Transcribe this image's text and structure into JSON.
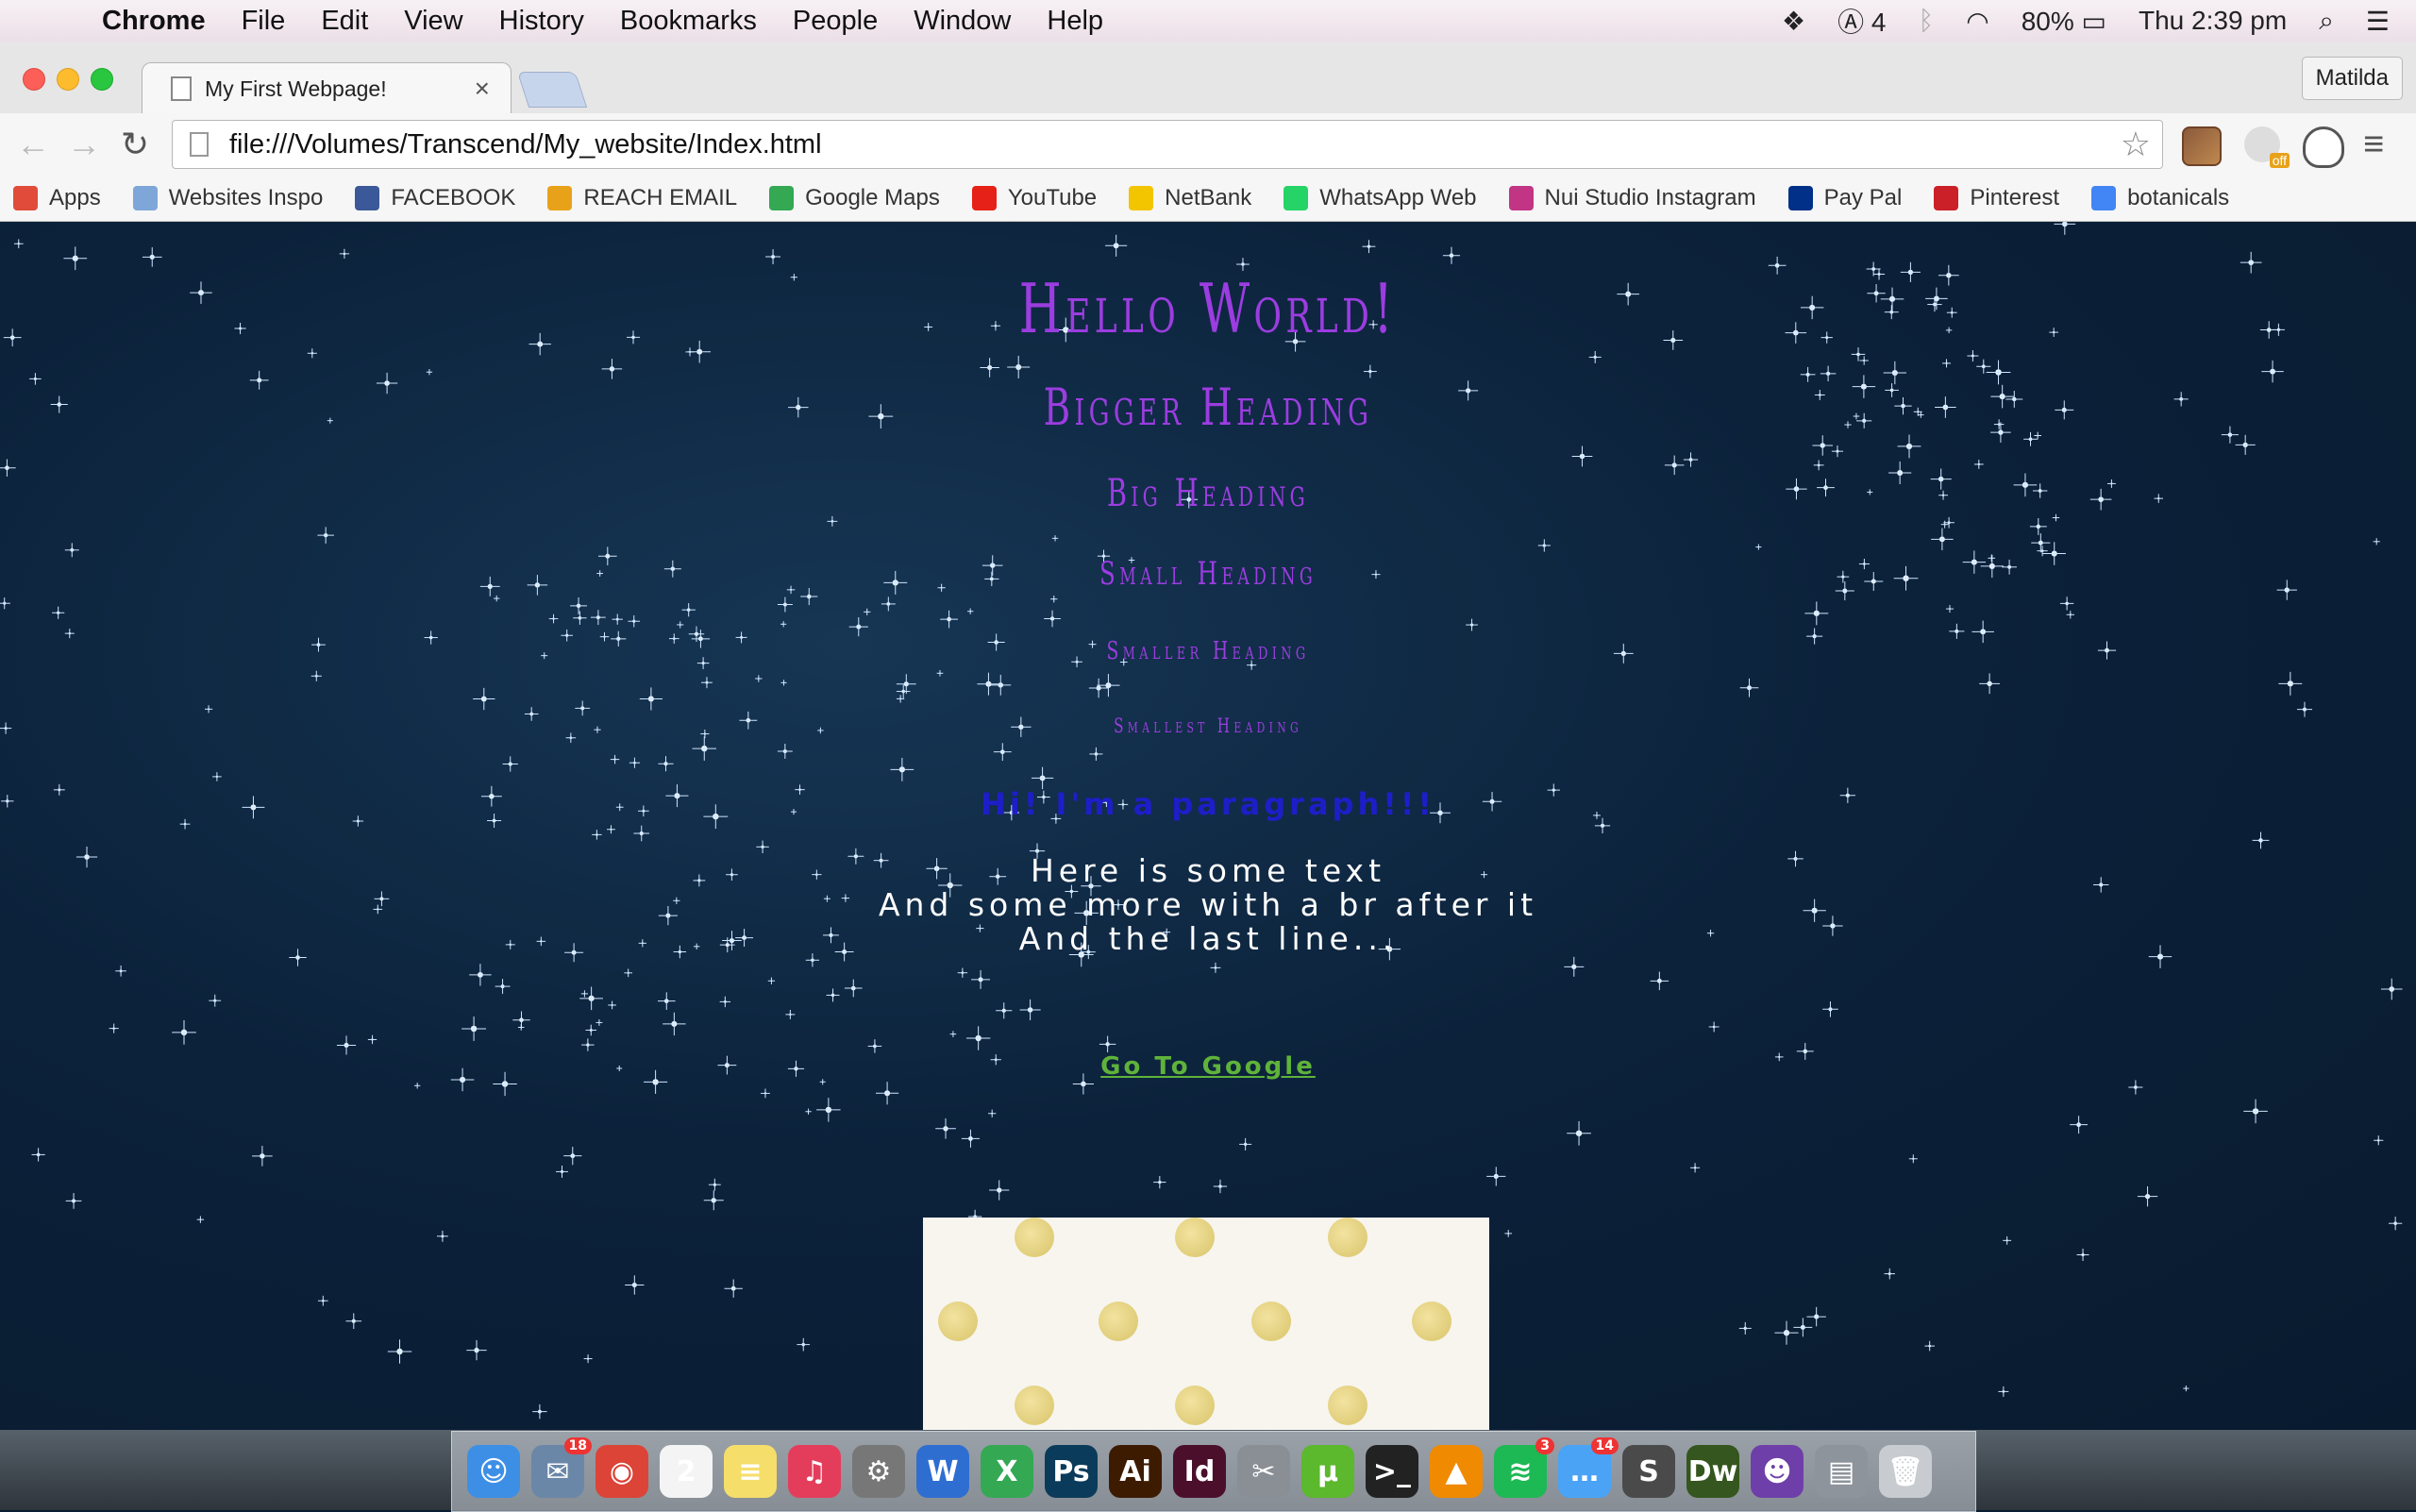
{
  "menubar": {
    "app": "Chrome",
    "items": [
      "File",
      "Edit",
      "View",
      "History",
      "Bookmarks",
      "People",
      "Window",
      "Help"
    ],
    "adobe_count": "4",
    "battery": "80%",
    "clock": "Thu 2:39 pm"
  },
  "browser": {
    "tab_title": "My First Webpage!",
    "profile_name": "Matilda",
    "url": "file:///Volumes/Transcend/My_website/Index.html",
    "bookmarks": [
      {
        "label": "Apps",
        "icon": "apps-grid-icon",
        "color": "#e04b3a"
      },
      {
        "label": "Websites Inspo",
        "icon": "folder-icon",
        "color": "#7ea6d8"
      },
      {
        "label": "FACEBOOK",
        "icon": "facebook-icon",
        "color": "#3b5998"
      },
      {
        "label": "REACH EMAIL",
        "icon": "outlook-icon",
        "color": "#e8a21a"
      },
      {
        "label": "Google Maps",
        "icon": "maps-icon",
        "color": "#34a853"
      },
      {
        "label": "YouTube",
        "icon": "youtube-icon",
        "color": "#e62117"
      },
      {
        "label": "NetBank",
        "icon": "netbank-icon",
        "color": "#f2c500"
      },
      {
        "label": "WhatsApp Web",
        "icon": "whatsapp-icon",
        "color": "#25d366"
      },
      {
        "label": "Nui Studio Instagram",
        "icon": "instagram-icon",
        "color": "#c13584"
      },
      {
        "label": "Pay Pal",
        "icon": "paypal-icon",
        "color": "#003087"
      },
      {
        "label": "Pinterest",
        "icon": "pinterest-icon",
        "color": "#cb2027"
      },
      {
        "label": "botanicals",
        "icon": "google-icon",
        "color": "#4285f4"
      }
    ]
  },
  "page": {
    "h1": "Hello World!",
    "h2": "Bigger Heading",
    "h3": "Big Heading",
    "h4": "Small Heading",
    "h5": "Smaller Heading",
    "h6": "Smallest Heading",
    "paragraph": "Hi! I'm a paragraph!!!",
    "text_lines": [
      "Here is some text",
      "And some more with a br after it",
      "And the last line..."
    ],
    "link": "Go To Google"
  },
  "dock": {
    "apps": [
      {
        "name": "finder-icon",
        "glyph": "☺",
        "color": "#3d8fe6"
      },
      {
        "name": "mail-icon",
        "glyph": "✉",
        "color": "#6b87a8",
        "badge": "18"
      },
      {
        "name": "chrome-icon",
        "glyph": "◉",
        "color": "#db4437"
      },
      {
        "name": "calendar-icon",
        "glyph": "2",
        "color": "#f4f4f4"
      },
      {
        "name": "notes-icon",
        "glyph": "≡",
        "color": "#f6de6b"
      },
      {
        "name": "itunes-icon",
        "glyph": "♫",
        "color": "#e43d5c"
      },
      {
        "name": "system-preferences-icon",
        "glyph": "⚙",
        "color": "#777"
      },
      {
        "name": "word-icon",
        "glyph": "W",
        "color": "#2f6ed1"
      },
      {
        "name": "excel-icon",
        "glyph": "X",
        "color": "#34a853"
      },
      {
        "name": "photoshop-icon",
        "glyph": "Ps",
        "color": "#0b3b5a"
      },
      {
        "name": "illustrator-icon",
        "glyph": "Ai",
        "color": "#3d1b00"
      },
      {
        "name": "indesign-icon",
        "glyph": "Id",
        "color": "#4b0f2b"
      },
      {
        "name": "utilities-icon",
        "glyph": "✂",
        "color": "#8a8f96"
      },
      {
        "name": "utorrent-icon",
        "glyph": "μ",
        "color": "#5cb82c"
      },
      {
        "name": "terminal-icon",
        "glyph": ">_",
        "color": "#222"
      },
      {
        "name": "vlc-icon",
        "glyph": "▲",
        "color": "#f08a00"
      },
      {
        "name": "spotify-icon",
        "glyph": "≋",
        "color": "#1db954",
        "badge": "3"
      },
      {
        "name": "messages-icon",
        "glyph": "…",
        "color": "#4aa3f5",
        "badge": "14"
      },
      {
        "name": "sublime-icon",
        "glyph": "S",
        "color": "#4a4a4a"
      },
      {
        "name": "dreamweaver-icon",
        "glyph": "Dw",
        "color": "#35561e"
      },
      {
        "name": "github-icon",
        "glyph": "☻",
        "color": "#6e3fa8"
      },
      {
        "name": "downloads-stack-icon",
        "glyph": "▤",
        "color": "#8d949b"
      },
      {
        "name": "trash-icon",
        "glyph": "🗑",
        "color": "#c8ccd0"
      }
    ]
  },
  "colors": {
    "heading": "#9b3de0",
    "paragraph": "#1e1ec8",
    "link": "#5fb33a",
    "background": "#0b1d33"
  }
}
